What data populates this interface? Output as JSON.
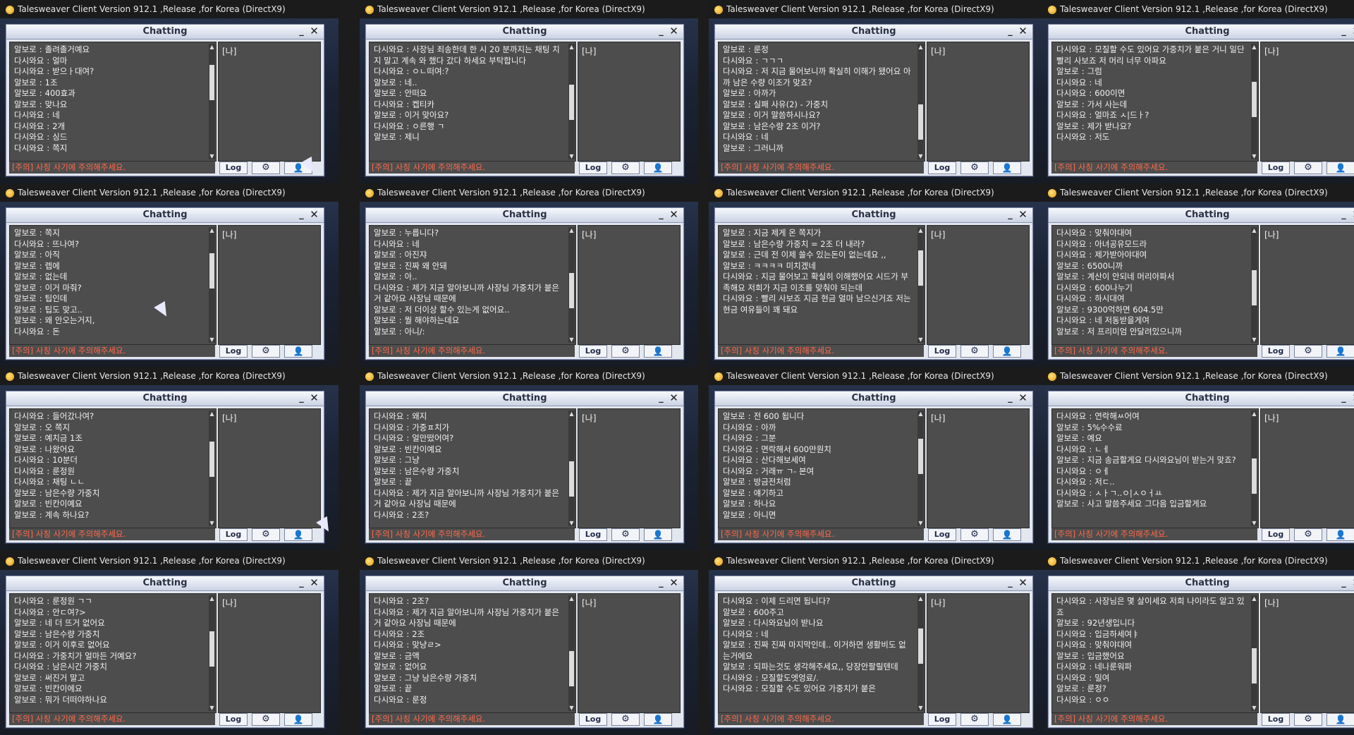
{
  "colors": {
    "speaker_yellow": "#f3e79a",
    "warning": "#ff6a4a",
    "panel": "#4d4d4d"
  },
  "icons": {
    "app": "game-app-icon",
    "minimize": "minimize-icon",
    "close": "close-icon",
    "gear": "gear-icon",
    "user": "user-plus-icon",
    "cursor": "mouse-cursor-icon"
  },
  "shared": {
    "window_title": "Talesweaver Client Version 912.1 ,Release ,for Korea (DirectX9)",
    "chat_title": "Chatting",
    "side_label": "[나]",
    "warning": "[주의] 사칭 사기에 주의해주세요.",
    "log_label": "Log",
    "minimize_glyph": "_",
    "close_glyph": "✕",
    "gear_glyph": "⚙",
    "user_glyph": "👤"
  },
  "cells": [
    {
      "messages": [
        {
          "s": "알보로",
          "t": "졸려졸거예요"
        },
        {
          "s": "다시와요",
          "t": "얼마"
        },
        {
          "s": "다시와요",
          "t": "받으ㅏ대여?"
        },
        {
          "s": "알보로",
          "t": "1조"
        },
        {
          "s": "알보로",
          "t": "400효과"
        },
        {
          "s": "알보로",
          "t": "맞나요"
        },
        {
          "s": "다시와요",
          "t": "네"
        },
        {
          "s": "다시와요",
          "t": "2개"
        },
        {
          "s": "다시와요",
          "t": "싱드"
        },
        {
          "s": "다시와요",
          "t": "쪽지"
        }
      ]
    },
    {
      "messages": [
        {
          "s": "알보로",
          "t": "쪽지"
        },
        {
          "s": "다시와요",
          "t": "뜨나여?"
        },
        {
          "s": "알보로",
          "t": "아직"
        },
        {
          "s": "알보로",
          "t": "렙에"
        },
        {
          "s": "알보로",
          "t": "없는데"
        },
        {
          "s": "알보로",
          "t": "이거 마줘?"
        },
        {
          "s": "알보로",
          "t": "팁인데"
        },
        {
          "s": "알보로",
          "t": "팁도 맞고.."
        },
        {
          "s": "알보로",
          "t": "왜 안오는거지,"
        },
        {
          "s": "다시와요",
          "t": "돈"
        }
      ]
    },
    {
      "messages": [
        {
          "s": "다시와요",
          "t": "들어갔나여?"
        },
        {
          "s": "알보로",
          "t": "오 쪽지"
        },
        {
          "s": "알보로",
          "t": "예치금 1조"
        },
        {
          "s": "알보로",
          "t": "나왔어요"
        },
        {
          "s": "다시와요",
          "t": "10분더"
        },
        {
          "s": "다시와요",
          "t": "룬정원"
        },
        {
          "s": "다시와요",
          "t": "채팅 ㄴㄴ"
        },
        {
          "s": "알보로",
          "t": "남은수량 가중치"
        },
        {
          "s": "알보로",
          "t": "빈칸이예요"
        },
        {
          "s": "알보로",
          "t": "계속 하나요?"
        }
      ]
    },
    {
      "messages": [
        {
          "s": "다시와요",
          "t": "룬정원 ㄱㄱ"
        },
        {
          "s": "다시와요",
          "t": "안ㄷ여?>"
        },
        {
          "s": "알보로",
          "t": "네 더 뜨거 없어요"
        },
        {
          "s": "알보로",
          "t": "남은수량 가중치"
        },
        {
          "s": "알보로",
          "t": "이거 이후로 없어요"
        },
        {
          "s": "다시와요",
          "t": "가중치가 얼마든 거예요?"
        },
        {
          "s": "다시와요",
          "t": "남은시간 가중치"
        },
        {
          "s": "알보로",
          "t": "써진거 말고"
        },
        {
          "s": "알보로",
          "t": "빈칸이에요"
        },
        {
          "s": "알보로",
          "t": "뭐가 더떠야하나요"
        }
      ]
    },
    {
      "messages": [
        {
          "s": "다시와요",
          "t": "사장님 죄송한데 한 시 20 분까지는 채팅 치지 말고 계속 와 했다 갔다 하세요 부탁합니다"
        },
        {
          "s": "다시와요",
          "t": "ㅇㄴ떠여:?"
        },
        {
          "s": "알보로",
          "t": "네.."
        },
        {
          "s": "알보로",
          "t": "안떠요"
        },
        {
          "s": "다시와요",
          "t": "켑티카"
        },
        {
          "s": "알보로",
          "t": "이거 맞아요?"
        },
        {
          "s": "다시와요",
          "t": "ㅇ른행 ㄱ"
        },
        {
          "s": "알보로",
          "t": "제니"
        }
      ]
    },
    {
      "messages": [
        {
          "s": "알보로",
          "t": "누릅니다?"
        },
        {
          "s": "다시와요",
          "t": "네"
        },
        {
          "s": "알보로",
          "t": "아진쟈"
        },
        {
          "s": "알보로",
          "t": "진짜 왜 안돼"
        },
        {
          "s": "알보로",
          "t": "아.."
        },
        {
          "s": "다시와요",
          "t": "제가 지금 알아보니까 사장님 가중치가 붙은 거 같아요 사장님 때문에"
        },
        {
          "s": "알보로",
          "t": "저 더이상 할수 있는게 없어요.."
        },
        {
          "s": "알보로",
          "t": "뭘 해야하는데요"
        },
        {
          "s": "알보로",
          "t": "아니/:"
        }
      ]
    },
    {
      "messages": [
        {
          "s": "다시와요",
          "t": "왜지"
        },
        {
          "s": "다시와요",
          "t": "가중ㅍ치가"
        },
        {
          "s": "다시와요",
          "t": "얼만떴어여?"
        },
        {
          "s": "알보로",
          "t": "빈칸이예요"
        },
        {
          "s": "알보로",
          "t": "그냥"
        },
        {
          "s": "알보로",
          "t": "남은수량 가중치"
        },
        {
          "s": "알보로",
          "t": "끝"
        },
        {
          "s": "다시와요",
          "t": "제가 지금 알아보니까 사장님 가중치가 붙은 거 같아요 사장님 때문에"
        },
        {
          "s": "다시와요",
          "t": "2조?"
        }
      ]
    },
    {
      "messages": [
        {
          "s": "다시와요",
          "t": "2조?"
        },
        {
          "s": "다시와요",
          "t": "제가 지금 알아보니까 사장님 가중치가 붙은 거 같아요 사장님 때문에"
        },
        {
          "s": "다시와요",
          "t": "2조"
        },
        {
          "s": "다시와요",
          "t": "맞냥ㄹ>"
        },
        {
          "s": "알보로",
          "t": "금액"
        },
        {
          "s": "알보로",
          "t": "없어요"
        },
        {
          "s": "알보로",
          "t": "그냥 남은수량 가중치"
        },
        {
          "s": "알보로",
          "t": "끝"
        },
        {
          "s": "다시와요",
          "t": "룬정"
        }
      ]
    },
    {
      "messages": [
        {
          "s": "알보로",
          "t": "룬정"
        },
        {
          "s": "다시와요",
          "t": "ㄱㄱㄱ"
        },
        {
          "s": "다시와요",
          "t": "저 지금 물어보니까 확실히 이해가 됐어요 아까 남은 수량 이조가 맞죠?"
        },
        {
          "s": "알보로",
          "t": "아까가"
        },
        {
          "s": "알보로",
          "t": "실패 사유(2) - 가중치"
        },
        {
          "s": "알보로",
          "t": "이거 말씀하시나요?"
        },
        {
          "s": "알보로",
          "t": "남은수량 2조 이거?"
        },
        {
          "s": "다시와요",
          "t": "네"
        },
        {
          "s": "알보로",
          "t": "그러니까"
        }
      ]
    },
    {
      "messages": [
        {
          "s": "알보로",
          "t": "지금 제게 온 쪽지가"
        },
        {
          "s": "알보로",
          "t": "남은수량 가중치 = 2조 더 내라?"
        },
        {
          "s": "알보로",
          "t": "근데 전 이제 쓸수 있는돈이 없는데요 ,,"
        },
        {
          "s": "알보로",
          "t": "ㅋㅋㅋㅋ 미치겠네"
        },
        {
          "s": "다시와요",
          "t": "지금 물어보고 확실히 이해했어요 시드가 부족해요 저희가 지금 이조를 맞춰야 되는데"
        },
        {
          "s": "다시와요",
          "t": "빨리 사보죠 지금 현금 얼마 남으신거죠 저는 현금 여유들이 꽤 돼요"
        }
      ]
    },
    {
      "messages": [
        {
          "s": "알보로",
          "t": "전 600 됩니다"
        },
        {
          "s": "다시와요",
          "t": "아까"
        },
        {
          "s": "다시와요",
          "t": "그분"
        },
        {
          "s": "다시와요",
          "t": "면락해서 600만원치"
        },
        {
          "s": "다시와요",
          "t": "산다해보세여"
        },
        {
          "s": "다시와요",
          "t": "거래ㅠ ㄱ- 본여"
        },
        {
          "s": "알보로",
          "t": "방금전처럼"
        },
        {
          "s": "알보로",
          "t": "얘기하고"
        },
        {
          "s": "알보로",
          "t": "하나요"
        },
        {
          "s": "알보로",
          "t": "아니면"
        }
      ]
    },
    {
      "messages": [
        {
          "s": "다시와요",
          "t": "이제 드리면 됩니다?"
        },
        {
          "s": "알보로",
          "t": "600주고"
        },
        {
          "s": "알보로",
          "t": "다시와요님이 받나요"
        },
        {
          "s": "다시와요",
          "t": "네"
        },
        {
          "s": "알보로",
          "t": "진짜 진짜 마지막인데.. 이거하면 생활비도 없는거에요"
        },
        {
          "s": "알보로",
          "t": "되파는것도 생각해주세요,, 당장안팔릴텐데"
        },
        {
          "s": "다시와요",
          "t": "모질할도엣엉료/."
        },
        {
          "s": "다시와요",
          "t": "모질할 수도 있어요 가중치가 붙은"
        }
      ]
    },
    {
      "messages": [
        {
          "s": "다시와요",
          "t": "모질할 수도 있어요 가중치가 붙은 거니 일단 빨리 사보죠 저 머리 너무 아파요"
        },
        {
          "s": "알보로",
          "t": "그럼"
        },
        {
          "s": "다시와요",
          "t": "네"
        },
        {
          "s": "다시와요",
          "t": "600이면"
        },
        {
          "s": "알보로",
          "t": "가서 사는데"
        },
        {
          "s": "다시와요",
          "t": "얼마죠 ㅅ|드ㅏ?"
        },
        {
          "s": "알보로",
          "t": "제가 받나요?"
        },
        {
          "s": "다시와요",
          "t": "저도"
        }
      ]
    },
    {
      "messages": [
        {
          "s": "다시와요",
          "t": "맞춰야대여"
        },
        {
          "s": "다시와요",
          "t": "아녀공유모드라"
        },
        {
          "s": "다시와요",
          "t": "제가받아야대여"
        },
        {
          "s": "알보로",
          "t": "6500니까"
        },
        {
          "s": "알보로",
          "t": "계산이 안되네 머리아파서"
        },
        {
          "s": "다시와요",
          "t": "600나누기"
        },
        {
          "s": "다시와요",
          "t": "하시대여"
        },
        {
          "s": "알보로",
          "t": "9300억하면 604.5만"
        },
        {
          "s": "다시와요",
          "t": "네 저동받을게여"
        },
        {
          "s": "알보로",
          "t": "저 프리미엄 안달려있으니까"
        }
      ]
    },
    {
      "messages": [
        {
          "s": "다시와요",
          "t": "연락해ㅆ어여"
        },
        {
          "s": "알보로",
          "t": "5%수수료"
        },
        {
          "s": "알보로",
          "t": "예요"
        },
        {
          "s": "다시와요",
          "t": "ㄴㅔ"
        },
        {
          "s": "알보로",
          "t": "지금 송금할게요 다시와요님이 받는거 맞죠?"
        },
        {
          "s": "다시와요",
          "t": "ㅇㅔ"
        },
        {
          "s": "다시와요",
          "t": "저ㄷ.."
        },
        {
          "s": "다시와요",
          "t": "ㅅㅏㄱ..ㅇ|ㅅㅇㅓㅛ"
        },
        {
          "s": "알보로",
          "t": "사고 말씀주세요 그다음 입금할게요"
        }
      ]
    },
    {
      "messages": [
        {
          "s": "다시와요",
          "t": "사장님은 몇 살이세요 저희 나이라도 알고 있죠"
        },
        {
          "s": "알보로",
          "t": "92년생입니다"
        },
        {
          "s": "다시와요",
          "t": "입금하세여ㅑ"
        },
        {
          "s": "다시와요",
          "t": "맞춰야대여"
        },
        {
          "s": "알보로",
          "t": "입금했어요"
        },
        {
          "s": "다시와요",
          "t": "네나룬워파"
        },
        {
          "s": "다시와요",
          "t": "밀여"
        },
        {
          "s": "알보로",
          "t": "룬정?"
        },
        {
          "s": "다시와요",
          "t": "ㅇㅇ"
        }
      ]
    }
  ]
}
